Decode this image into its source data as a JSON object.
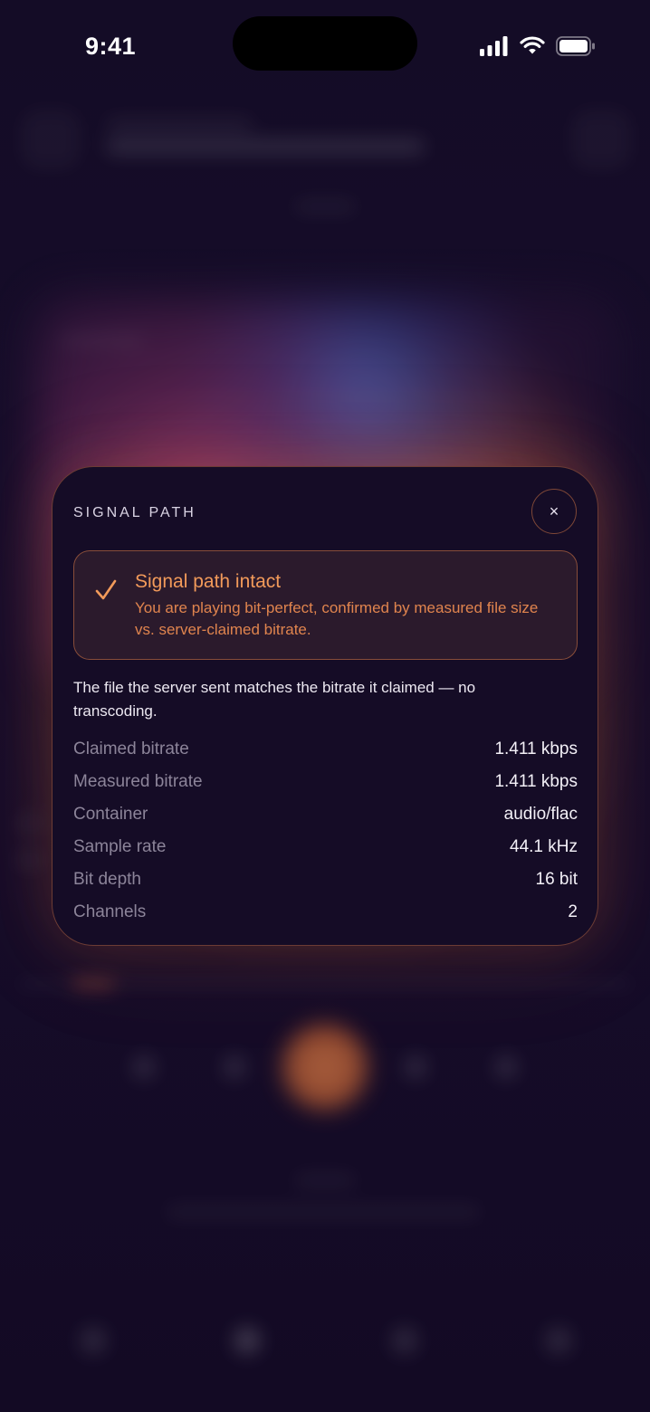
{
  "status_bar": {
    "time": "9:41"
  },
  "modal": {
    "title": "SIGNAL PATH",
    "close_label": "×",
    "status": {
      "icon": "check-icon",
      "heading": "Signal path intact",
      "subtext": "You are playing bit-perfect, confirmed by measured file size vs. server-claimed bitrate."
    },
    "description": "The file the server sent matches the bitrate it claimed — no transcoding.",
    "metrics": [
      {
        "label": "Claimed bitrate",
        "value": "1.411 kbps"
      },
      {
        "label": "Measured bitrate",
        "value": "1.411 kbps"
      },
      {
        "label": "Container",
        "value": "audio/flac"
      },
      {
        "label": "Sample rate",
        "value": "44.1 kHz"
      },
      {
        "label": "Bit depth",
        "value": "16 bit"
      },
      {
        "label": "Channels",
        "value": "2"
      }
    ]
  },
  "colors": {
    "accent": "#f29a5a",
    "accent_border": "#d6784680",
    "modal_background": "#150c26",
    "page_background": "#140c26"
  }
}
